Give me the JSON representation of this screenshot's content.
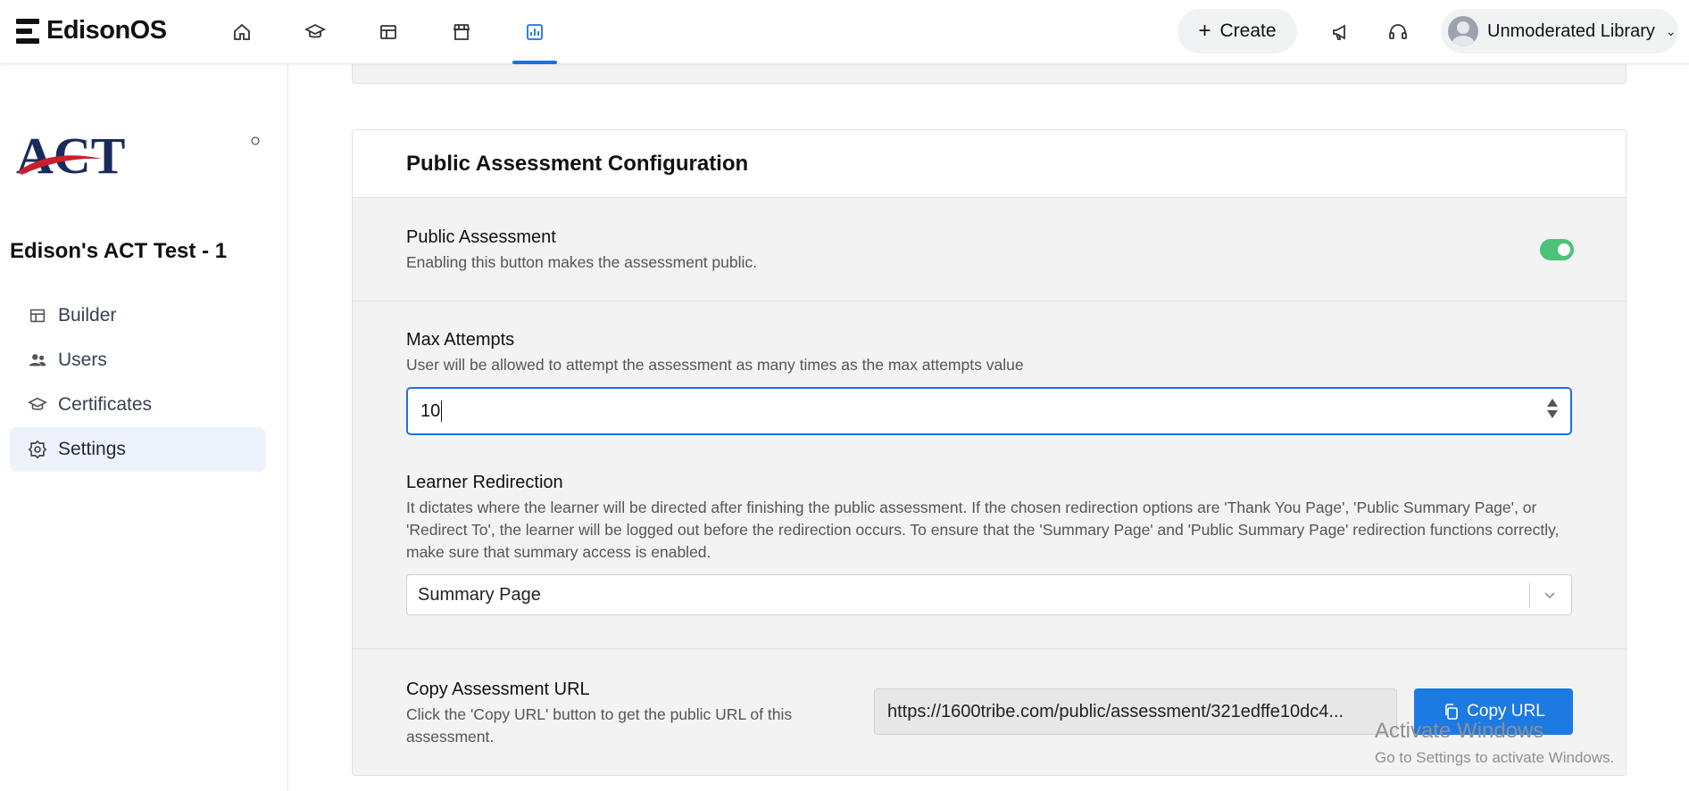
{
  "app": {
    "name": "EdisonOS"
  },
  "topbar": {
    "create_label": "Create",
    "user_name": "Unmoderated Library",
    "accent_color": "#1d6fe0"
  },
  "nav": {
    "icons": [
      "home-icon",
      "graduation-cap-icon",
      "layout-icon",
      "store-icon",
      "chart-icon"
    ],
    "active": "chart-icon"
  },
  "sidebar": {
    "logo_text": "ACT",
    "course_title": "Edison's ACT Test - 1",
    "items": [
      {
        "label": "Builder",
        "icon": "builder-icon"
      },
      {
        "label": "Users",
        "icon": "users-icon"
      },
      {
        "label": "Certificates",
        "icon": "certificate-icon"
      },
      {
        "label": "Settings",
        "icon": "gear-icon",
        "active": true
      }
    ]
  },
  "config": {
    "title": "Public Assessment Configuration",
    "public_assessment": {
      "title": "Public Assessment",
      "desc": "Enabling this button makes the assessment public.",
      "enabled": true,
      "toggle_color": "#4cc277"
    },
    "max_attempts": {
      "title": "Max Attempts",
      "desc": "User will be allowed to attempt the assessment as many times as the max attempts value",
      "value": "10"
    },
    "redirection": {
      "title": "Learner Redirection",
      "desc": "It dictates where the learner will be directed after finishing the public assessment. If the chosen redirection options are 'Thank You Page', 'Public Summary Page', or 'Redirect To', the learner will be logged out before the redirection occurs. To ensure that the 'Summary Page' and 'Public Summary Page' redirection functions correctly, make sure that summary access is enabled.",
      "selected": "Summary Page"
    },
    "copy_url": {
      "title": "Copy Assessment URL",
      "desc": "Click the 'Copy URL' button to get the public URL of this assessment.",
      "url": "https://1600tribe.com/public/assessment/321edffe10dc4...",
      "button_label": "Copy URL",
      "button_color": "#1d7ae3"
    }
  },
  "watermark": {
    "line1": "Activate Windows",
    "line2": "Go to Settings to activate Windows."
  }
}
